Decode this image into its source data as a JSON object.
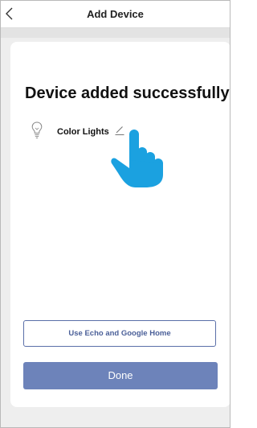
{
  "header": {
    "title": "Add Device",
    "back_icon": "chevron-left-icon"
  },
  "main": {
    "success_title": "Device added successfully",
    "device": {
      "icon": "light-bulb-icon",
      "name": "Color Lights",
      "edit_icon": "pencil-icon"
    },
    "pointer_icon": "pointing-hand-icon",
    "pointer_color": "#1ba1e0"
  },
  "buttons": {
    "echo_label": "Use Echo and Google Home",
    "done_label": "Done"
  },
  "colors": {
    "accent": "#6d83ba",
    "accent_border": "#5a6fa8",
    "background": "#eeeeee",
    "card": "#ffffff"
  }
}
